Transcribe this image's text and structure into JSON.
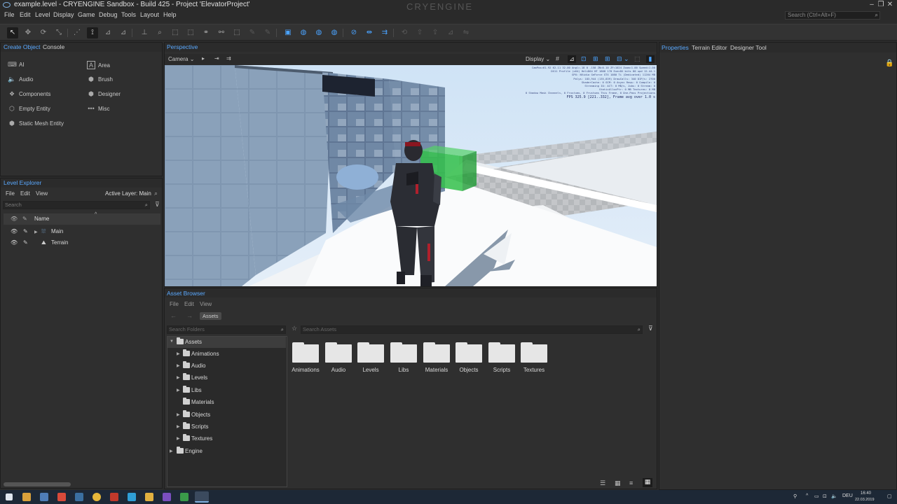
{
  "window": {
    "title": "example.level - CRYENGINE Sandbox - Build 425 - Project 'ElevatorProject'",
    "logo": "CRYENGINE"
  },
  "menu": [
    "File",
    "Edit",
    "Level",
    "Display",
    "Game",
    "Debug",
    "Tools",
    "Layout",
    "Help"
  ],
  "search": {
    "placeholder": "Search (Ctrl+Alt+F)"
  },
  "create_panel": {
    "tabs": [
      "Create Object",
      "Console"
    ],
    "items": [
      "AI",
      "Audio",
      "Components",
      "Empty Entity",
      "Static Mesh Entity",
      "Area",
      "Brush",
      "Designer",
      "Misc"
    ]
  },
  "level_explorer": {
    "title": "Level Explorer",
    "menu": [
      "File",
      "Edit",
      "View"
    ],
    "active_layer": "Active Layer: Main",
    "search_placeholder": "Search",
    "column_name": "Name",
    "rows": [
      "Main",
      "Terrain"
    ]
  },
  "viewport": {
    "title": "Perspective",
    "camera_label": "Camera",
    "display_label": "Display",
    "stats_fps": "FPS 325.9 [221..332], Frame avg over 1.0 s",
    "stats_lines": [
      "CamPos=61.92 62.11 32.00 Angl=-18 0 -158 ZN=0.10 ZF=1024 Zoom=1.00 Speed=1.00",
      "DX11 Profile (x64) HeliD64 HF 1808 170 ExecDX bits 80 upd 12.44.1",
      "GPU: NVidia GeForce GTX 1080 Ti (Dedicated) 11264 MB",
      "Polys: 183,944 (135,839) DrawCalls: 340 DIP/s: 2700",
      "ShaderCache: 0 GCM: 0 Async Reqs: 0 Compile: 0",
      "Streaming IO: ACT: 0 MB/s, Jobs: 0 Stream: 0",
      "StaticAllocPtr: 0 MB Textures: 0 MB",
      "0 Shadow Mask Channels, 0 Frustums, 0 Frustums This Frame, 0 One-Pass Projections"
    ]
  },
  "right_panel": {
    "tabs": [
      "Properties",
      "Terrain Editor",
      "Designer Tool"
    ]
  },
  "asset_browser": {
    "title": "Asset Browser",
    "menu": [
      "File",
      "Edit",
      "View"
    ],
    "breadcrumb": "Assets",
    "folders_placeholder": "Search Folders",
    "assets_placeholder": "Search Assets",
    "tree": [
      {
        "label": "Assets",
        "level": 0,
        "expanded": true,
        "selected": true
      },
      {
        "label": "Animations",
        "level": 1
      },
      {
        "label": "Audio",
        "level": 1
      },
      {
        "label": "Levels",
        "level": 1
      },
      {
        "label": "Libs",
        "level": 1
      },
      {
        "label": "Materials",
        "level": 1,
        "no_arrow": true
      },
      {
        "label": "Objects",
        "level": 1
      },
      {
        "label": "Scripts",
        "level": 1
      },
      {
        "label": "Textures",
        "level": 1
      },
      {
        "label": "Engine",
        "level": 0
      }
    ],
    "folders": [
      "Animations",
      "Audio",
      "Levels",
      "Libs",
      "Materials",
      "Objects",
      "Scripts",
      "Textures"
    ]
  },
  "taskbar": {
    "lang": "DEU",
    "time": "16:40",
    "date": "22.03.2019"
  },
  "colors": {
    "accent": "#4aa3ff",
    "panel": "#2f2f2f",
    "taskbar": "#1d2836"
  }
}
